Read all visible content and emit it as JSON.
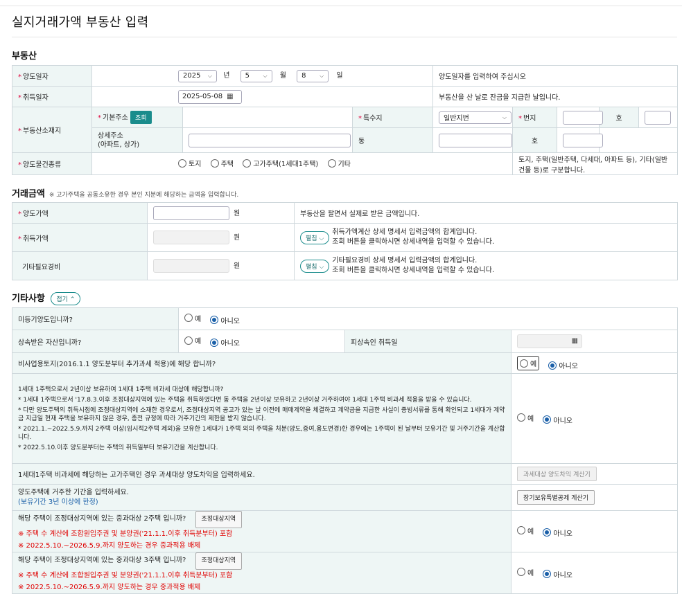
{
  "page_title": "실지거래가액 부동산 입력",
  "sections": {
    "property": "부동산",
    "amount": "거래금액",
    "amount_note": "※ 고가주택을 공동소유한 경우 본인 지분에 해당하는 금액을 입력합니다.",
    "other": "기타사항",
    "collapse_label": "접기"
  },
  "required_mark": "*",
  "property": {
    "transfer_date_label": "양도일자",
    "year": "2025",
    "year_unit": "년",
    "month": "5",
    "month_unit": "월",
    "day": "8",
    "day_unit": "일",
    "transfer_date_help": "양도일자를 입력하여 주십시오",
    "acquire_date_label": "취득일자",
    "acquire_date": "2025-05-08",
    "acquire_date_help": "부동산을 산 날로 잔금을 지급한 날입니다.",
    "location_label": "부동산소재지",
    "basic_address_label": "기본주소",
    "lookup_button": "조회",
    "special_label": "특수지",
    "special_value": "일반지번",
    "lot_label": "번지",
    "ho_label": "호",
    "detail_address_label": "상세주소\n(아파트, 상가)",
    "dong_label": "동",
    "type_label": "양도물건종류",
    "type_options": [
      "토지",
      "주택",
      "고가주택(1세대1주택)",
      "기타"
    ],
    "type_help": "토지, 주택(일반주택, 다세대, 아파트 등), 기타(일반건물 등)로 구분합니다."
  },
  "amount": {
    "transfer_price_label": "양도가액",
    "won": "원",
    "transfer_price_help": "부동산을 팔면서 실제로 받은 금액입니다.",
    "acquire_price_label": "취득가액",
    "expand_label": "펼침",
    "acquire_price_help1": "취득가액계산 상세 명세서 입력금액의 합계입니다.",
    "acquire_price_help2": "조회 버튼을 클릭하시면 상세내역을 입력할 수 있습니다.",
    "other_expense_label": "기타필요경비",
    "other_expense_help1": "기타필요경비 상세 명세서 입력금액의 합계입니다.",
    "other_expense_help2": "조회 버튼을 클릭하시면 상세내역을 입력할 수 있습니다."
  },
  "other": {
    "yes": "예",
    "no": "아니오",
    "q_unregistered": "미등기양도입니까?",
    "q_inherited": "상속받은 자산입니까?",
    "decedent_acq_label": "피상속인 취득일",
    "q_nonbusiness_land": "비사업용토지(2016.1.1 양도분부터 추가과세 적용)에 해당 합니까?",
    "q_one_house": "1세대 1주택으로서 2년이상 보유하여 1세대 1주택 비과세 대상에 해당합니까?",
    "one_house_notes": [
      "* 1세대 1주택으로서 '17.8.3.이후 조정대상지역에 있는 주택을 취득하였다면 동 주택을 2년이상 보유하고 2년이상 거주하여야 1세대 1주택 비과세 적용을 받을 수 있습니다.",
      "* 다만 양도주택의 취득시점에 조정대상지역에 소재한 경우로서, 조정대상지역 공고가 있는 날 이전에 매매계약을 체결하고 계약금을 지급한 사실이 증빙서류를 통해 확인되고 1세대가 계약금 지급일 현재 주택을 보유하지 않은 경우, 종전 규정에 따라 거주기간의 제한을 받지 않습니다.",
      "* 2021.1.~2022.5.9.까지 2주택 이상(임시적2주택 제외)을 보유한 1세대가 1주택 외의 주택을 처분(양도,증여,용도변경)한 경우에는 1주택이 된 날부터 보유기간 및 거주기간을 계산합니다.",
      "* 2022.5.10.이후 양도분부터는 주택의 취득일부터 보유기간을 계산합니다."
    ],
    "q_high_price": "1세대1주택 비과세에 해당하는 고가주택인 경우 과세대상 양도차익을 입력하세요.",
    "high_price_button": "과세대상 양도차익 계산기",
    "q_residence": "양도주택에 거주한 기간을 입력하세요.",
    "residence_note": "(보유기간 3년 이상에 한정)",
    "residence_button": "장기보유특별공제 계산기",
    "q_2house": "해당 주택이 조정대상지역에 있는 중과대상 2주택 입니까?",
    "q_3house": "해당 주택이 조정대상지역에 있는 중과대상 3주택 입니까?",
    "adjust_area_button": "조정대상지역",
    "heavy_note1": "※ 주택 수 계산에 조합원입주권 및 분양권('21.1.1.이후 취득분부터) 포함",
    "heavy_note2": "※ 2022.5.10.~2026.5.9.까지 양도하는 경우 중과적용 배제"
  },
  "icons": {
    "calendar": "calendar-icon",
    "chevron": "chevron-down-icon"
  },
  "colors": {
    "accent": "#1a8c8c",
    "label_bg": "#eef6f5",
    "warning": "#e00000",
    "link": "#1a5fa8"
  }
}
